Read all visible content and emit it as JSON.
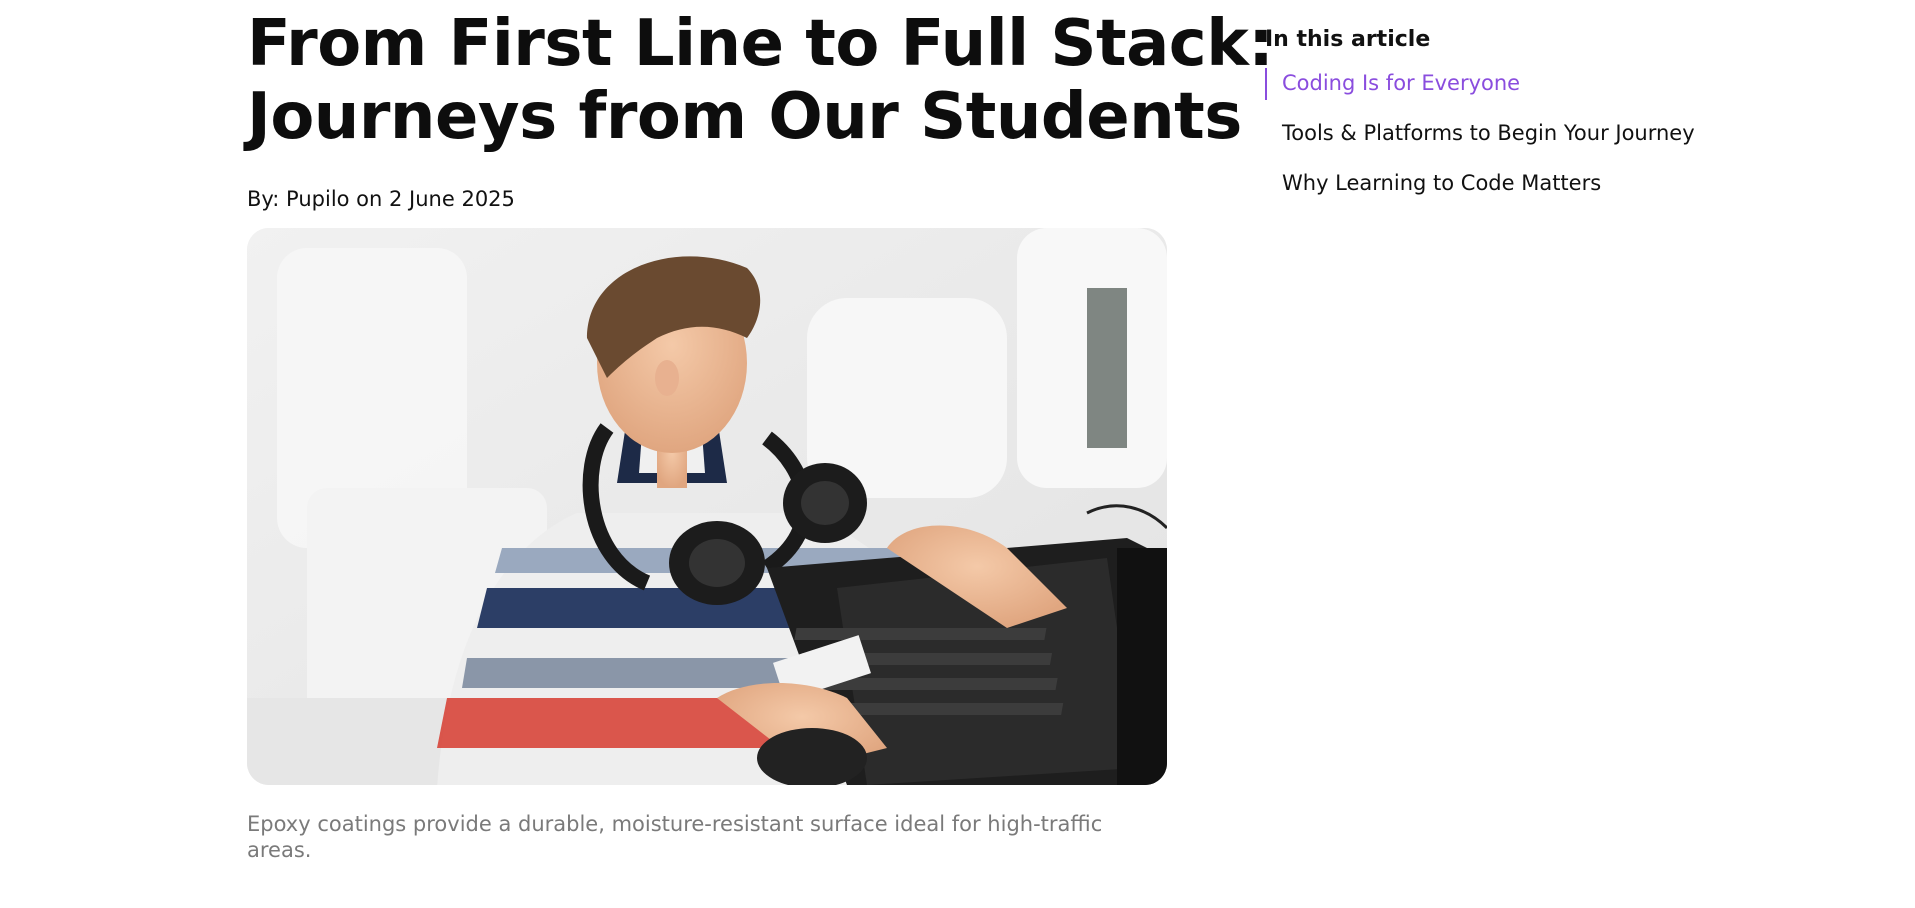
{
  "article": {
    "title_lines": [
      "From First Line to Full Stack:",
      "Journeys from Our Students"
    ],
    "byline": "By: Pupilo on 2 June 2025",
    "hero_image": "boy-using-laptop-with-headphones",
    "caption": "Epoxy coatings provide a durable, moisture-resistant surface ideal for high-traffic areas."
  },
  "toc": {
    "heading": "In this article",
    "items": [
      {
        "label": "Coding Is for Everyone",
        "active": true
      },
      {
        "label": "Tools & Platforms to Begin Your Journey",
        "active": false
      },
      {
        "label": "Why Learning to Code Matters",
        "active": false
      }
    ]
  },
  "colors": {
    "accent": "#8a4dde",
    "text": "#111111",
    "caption": "#7a7a7a",
    "background": "#ffffff"
  }
}
